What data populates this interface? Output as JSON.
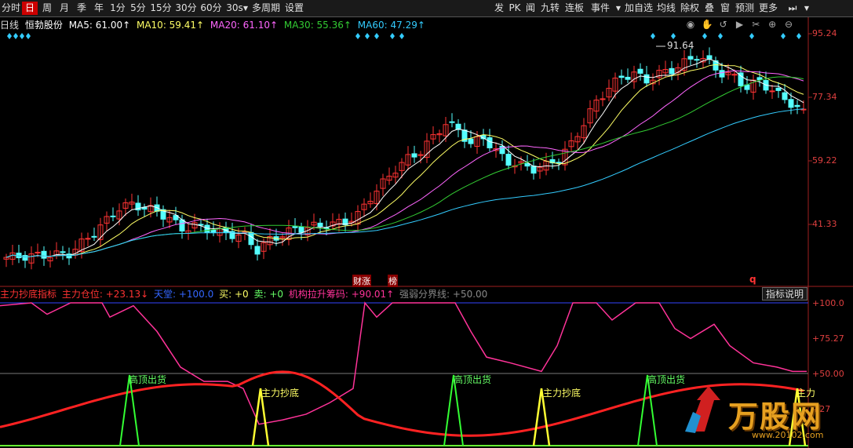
{
  "toolbar": {
    "left": [
      "分时",
      "日",
      "周",
      "月",
      "季",
      "年",
      "1分",
      "5分",
      "15分",
      "30分",
      "60分",
      "30s",
      "多周期",
      "设置"
    ],
    "right": [
      "发",
      "PK",
      "闻",
      "九转",
      "连板",
      "事件",
      "加自选",
      "均线",
      "除权",
      "叠",
      "窗",
      "预测",
      "更多"
    ],
    "active": "日"
  },
  "info": {
    "period": "日线",
    "stock": "恒勃股份",
    "ma5": "MA5: 61.00↑",
    "ma10": "MA10: 59.41↑",
    "ma20": "MA20: 61.10↑",
    "ma30": "MA30: 55.36↑",
    "ma60": "MA60: 47.29↑"
  },
  "main_axis": [
    "95.24",
    "77.34",
    "59.22",
    "41.33"
  ],
  "peak_label": "91.64",
  "event_tags": [
    "财涨",
    "榜",
    "q"
  ],
  "indicator": {
    "name": "主力抄底指标",
    "pos": "主力仓位: +23.13↓",
    "ceiling": "天堂: +100.0",
    "buy": "买: +0",
    "sell": "卖: +0",
    "inst": "机构拉升筹码: +90.01↑",
    "weak": "强弱分界线: +50.00",
    "help_button": "指标说明"
  },
  "ind_axis": [
    "+100.0",
    "+75.27",
    "+50.00",
    "+27"
  ],
  "signals": {
    "top": "高顶出货",
    "bottom": "主力抄底",
    "bottom_cut": "主力"
  },
  "watermark": "万股网",
  "watermark_url": "www.20102.com",
  "colors": {
    "ma5": "#ffffff",
    "ma10": "#ffff66",
    "ma20": "#ff66ff",
    "ma30": "#33cc33",
    "ma60": "#33ccff",
    "up": "#ff3333",
    "down": "#55ffff"
  }
}
